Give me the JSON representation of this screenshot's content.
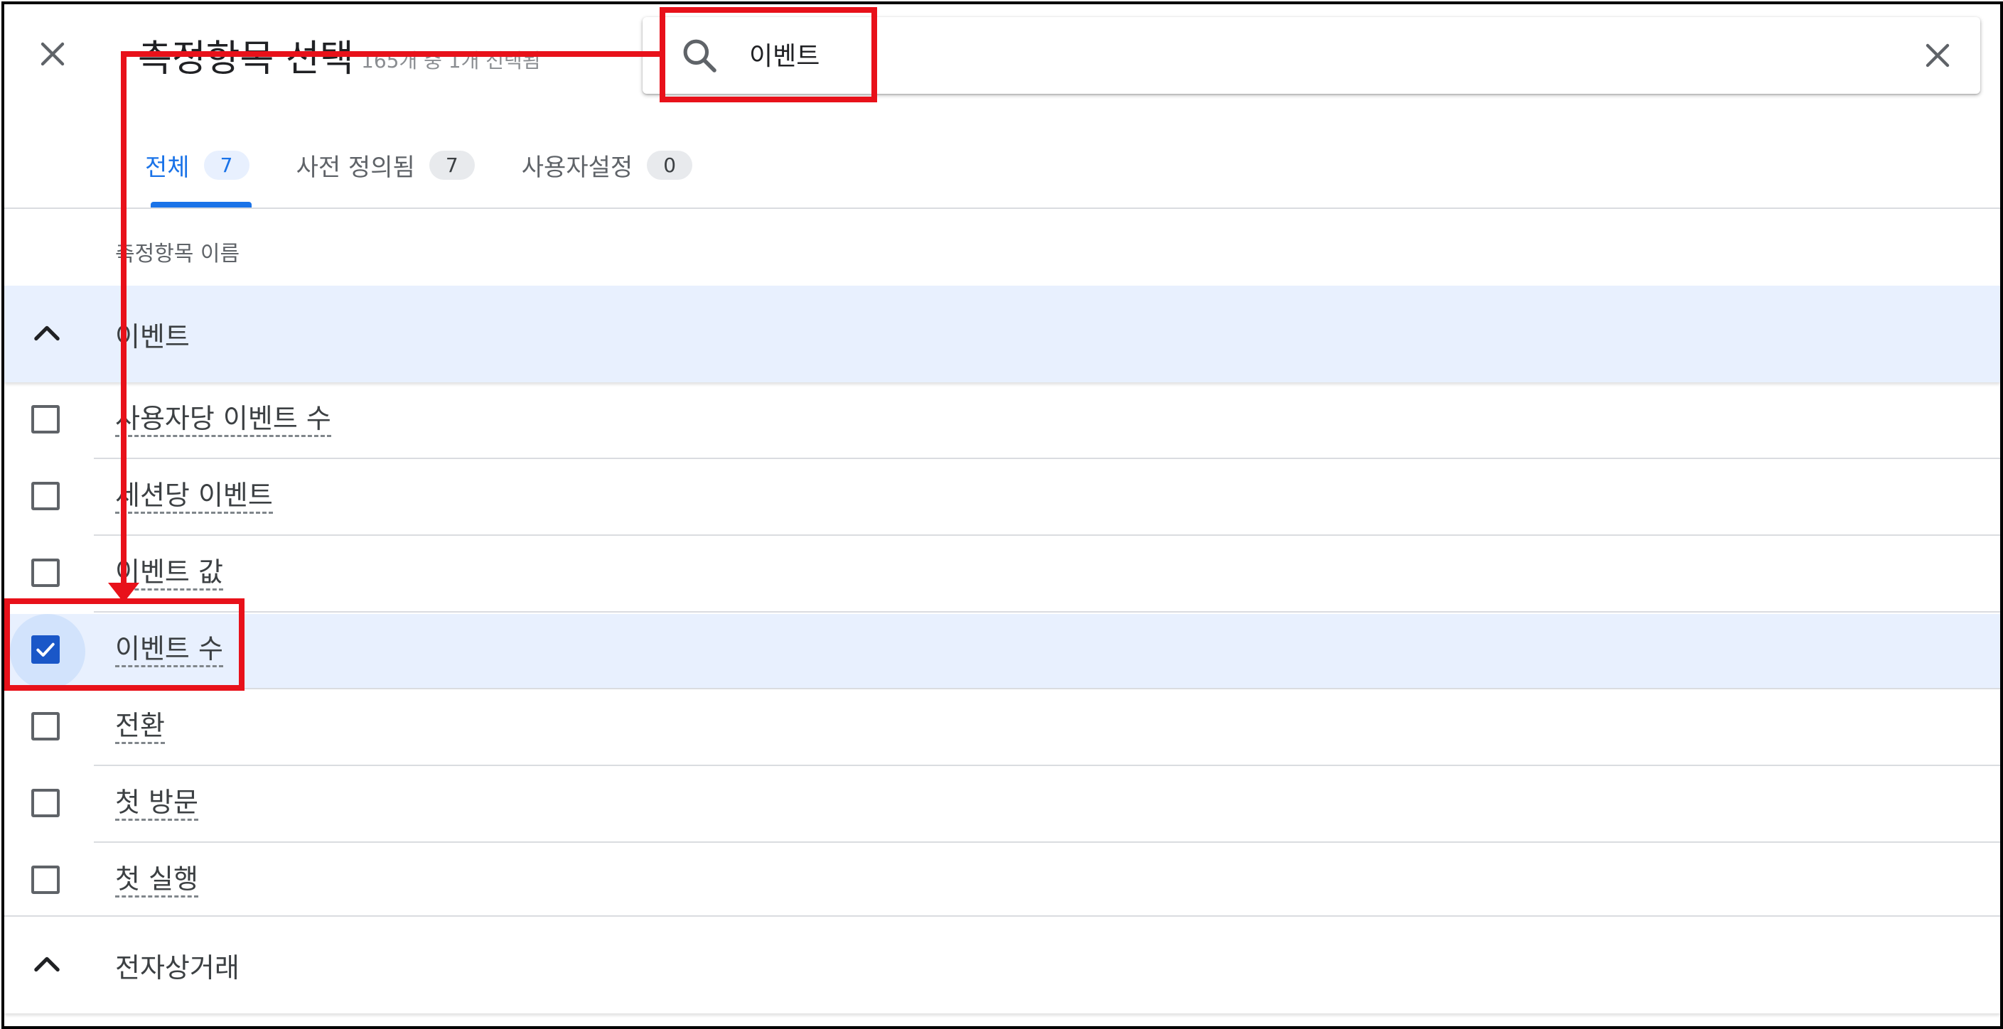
{
  "dialog": {
    "title": "측정항목 선택",
    "subtitle": "165개 중 1개 선택됨"
  },
  "search": {
    "value": "이벤트",
    "placeholder": ""
  },
  "tabs": [
    {
      "label": "전체",
      "count": "7",
      "active": true
    },
    {
      "label": "사전 정의됨",
      "count": "7",
      "active": false
    },
    {
      "label": "사용자설정",
      "count": "0",
      "active": false
    }
  ],
  "table": {
    "column_header": "측정항목 이름"
  },
  "groups": [
    {
      "label": "이벤트",
      "expanded": true
    },
    {
      "label": "전자상거래",
      "expanded": true
    }
  ],
  "metrics": [
    {
      "label": "사용자당 이벤트 수",
      "checked": false
    },
    {
      "label": "세션당 이벤트",
      "checked": false
    },
    {
      "label": "이벤트 값",
      "checked": false
    },
    {
      "label": "이벤트 수",
      "checked": true
    },
    {
      "label": "전환",
      "checked": false
    },
    {
      "label": "첫 방문",
      "checked": false
    },
    {
      "label": "첫 실행",
      "checked": false
    }
  ],
  "icons": {
    "close": "close-icon",
    "search": "search-icon",
    "clear": "clear-icon",
    "chevron": "chevron-up-icon",
    "check": "check-icon"
  },
  "colors": {
    "accent": "#1a73e8",
    "selected_row": "#e8f0fe",
    "annotation": "#e8111a",
    "checkbox_checked": "#1a57c8"
  }
}
